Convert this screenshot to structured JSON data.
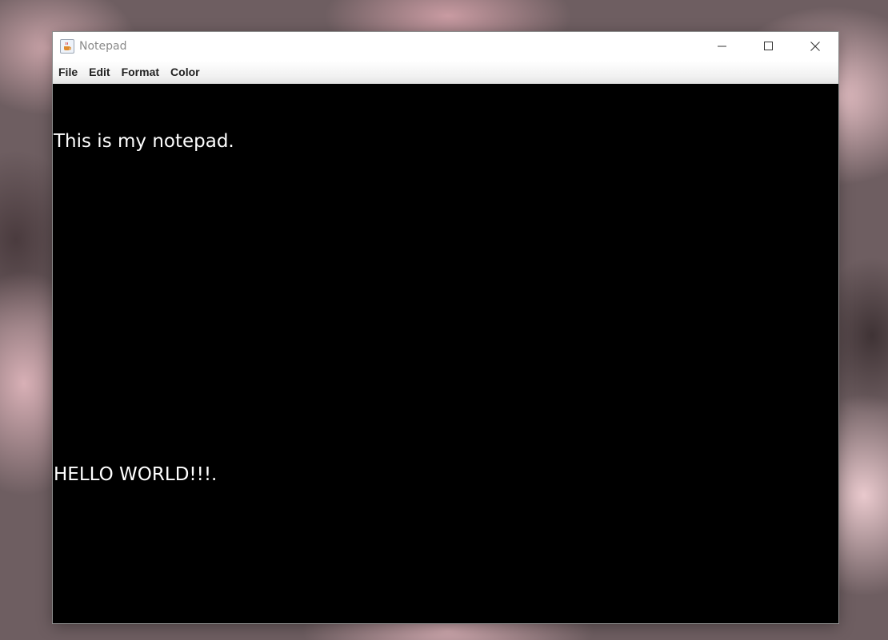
{
  "window": {
    "title": "Notepad",
    "app_icon": "java-cup-icon"
  },
  "controls": {
    "minimize_icon": "minimize-icon",
    "maximize_icon": "maximize-icon",
    "close_icon": "close-icon"
  },
  "menubar": {
    "items": [
      {
        "label": "File"
      },
      {
        "label": "Edit"
      },
      {
        "label": "Format"
      },
      {
        "label": "Color"
      }
    ]
  },
  "editor": {
    "lines": [
      "This is my notepad.",
      "",
      "",
      "",
      "",
      "HELLO WORLD!!!."
    ],
    "background": "#000000",
    "foreground": "#ffffff"
  }
}
